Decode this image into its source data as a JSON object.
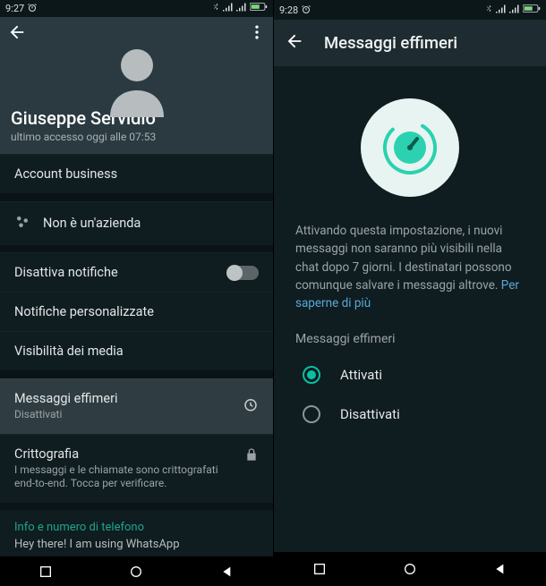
{
  "left": {
    "status_time": "9:27",
    "contact_name": "Giuseppe Servidio",
    "last_seen": "ultimo accesso oggi alle 07:53",
    "account_business": "Account business",
    "not_company": "Non è un'azienda",
    "disable_notifications": "Disattiva notifiche",
    "custom_notifications": "Notifiche personalizzate",
    "media_visibility": "Visibilità dei media",
    "ephemeral_title": "Messaggi effimeri",
    "ephemeral_value": "Disattivati",
    "encryption_title": "Crittografia",
    "encryption_sub": "I messaggi e le chiamate sono crittografati end-to-end. Tocca per verificare.",
    "info_header": "Info e numero di telefono",
    "status_text": "Hey there! I am using WhatsApp"
  },
  "right": {
    "status_time": "9:28",
    "title": "Messaggi effimeri",
    "description": "Attivando questa impostazione, i nuovi messaggi non saranno più visibili nella chat dopo 7 giorni. I destinatari possono comunque salvare i messaggi altrove. ",
    "learn_more": "Per saperne di più",
    "group_label": "Messaggi effimeri",
    "option_on": "Attivati",
    "option_off": "Disattivati",
    "selected": "on"
  }
}
